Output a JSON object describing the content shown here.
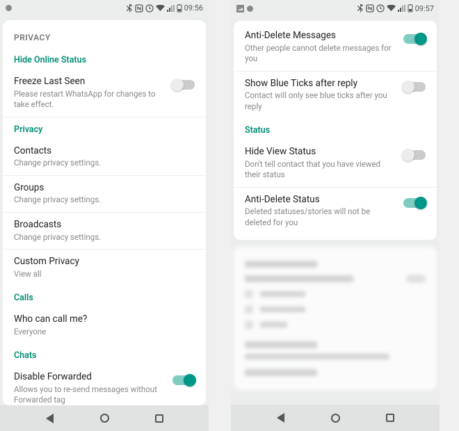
{
  "left": {
    "status": {
      "time": "09:56"
    },
    "header": "PRIVACY",
    "sections": {
      "hide_online": {
        "header": "Hide Online Status",
        "freeze": {
          "title": "Freeze Last Seen",
          "sub": "Please restart WhatsApp for changes to take effect.",
          "on": false
        }
      },
      "privacy": {
        "header": "Privacy",
        "contacts": {
          "title": "Contacts",
          "sub": "Change privacy settings."
        },
        "groups": {
          "title": "Groups",
          "sub": "Change privacy settings."
        },
        "broadcasts": {
          "title": "Broadcasts",
          "sub": "Change privacy settings."
        },
        "custom": {
          "title": "Custom Privacy",
          "sub": "View all"
        }
      },
      "calls": {
        "header": "Calls",
        "who": {
          "title": "Who can call me?",
          "sub": "Everyone"
        }
      },
      "chats": {
        "header": "Chats",
        "disable_fwd": {
          "title": "Disable Forwarded",
          "sub": "Allows you to re-send messages without Forwarded tag",
          "on": true
        }
      }
    }
  },
  "right": {
    "status": {
      "time": "09:57"
    },
    "rows": {
      "anti_delete_msg": {
        "title": "Anti-Delete Messages",
        "sub": "Other people cannot delete messages for you",
        "on": true
      },
      "blue_ticks": {
        "title": "Show Blue Ticks after reply",
        "sub": "Contact will only see blue ticks after you reply",
        "on": false
      }
    },
    "status_section": {
      "header": "Status",
      "hide_view": {
        "title": "Hide View Status",
        "sub": "Don't tell contact that you have viewed their status",
        "on": false
      },
      "anti_delete_status": {
        "title": "Anti-Delete Status",
        "sub": "Deleted statuses/stories will not be deleted for you",
        "on": true
      }
    }
  }
}
